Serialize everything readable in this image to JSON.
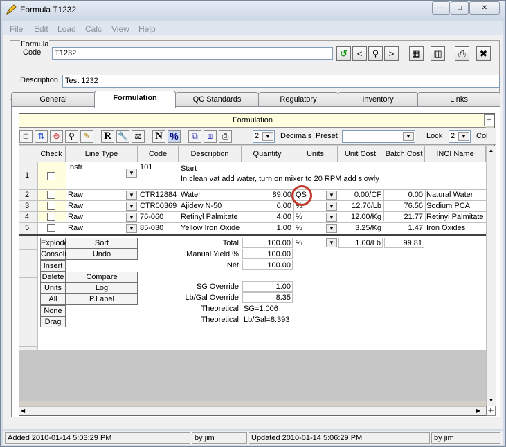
{
  "window": {
    "title": "Formula T1232"
  },
  "menu": [
    "File",
    "Edit",
    "Load",
    "Calc",
    "View",
    "Help"
  ],
  "formula": {
    "group_label": "Formula",
    "code_label": "Code",
    "code_value": "T1232",
    "description_label": "Description",
    "description_value": "Test 1232"
  },
  "tabs": [
    "General",
    "Formulation",
    "QC Standards",
    "Regulatory",
    "Inventory",
    "Links"
  ],
  "active_tab": "Formulation",
  "formulation": {
    "header": "Formulation",
    "decimals_value": "2",
    "decimals_label": "Decimals",
    "preset_label": "Preset",
    "preset_value": "",
    "lock_label": "Lock",
    "lock_value": "2",
    "col_label": "Col",
    "columns": [
      "Check",
      "Line Type",
      "Code",
      "Description",
      "Quantity",
      "Units",
      "Unit Cost",
      "Batch Cost",
      "INCI Name"
    ],
    "rows": [
      {
        "num": "1",
        "type": "Instr",
        "code": "101",
        "desc": "Start",
        "desc2": "In clean vat add water, turn on mixer to 20 RPM add slowly",
        "qty": "",
        "units": "",
        "unit_cost": "",
        "batch_cost": "",
        "inci": ""
      },
      {
        "num": "2",
        "type": "Raw",
        "code": "CTR12884",
        "desc": "Water",
        "qty": "89.00",
        "units": "QS",
        "unit_cost": "0.00/CF",
        "batch_cost": "0.00",
        "inci": "Natural Water"
      },
      {
        "num": "3",
        "type": "Raw",
        "code": "CTR00369",
        "desc": "Ajidew N-50",
        "qty": "6.00",
        "units": "%",
        "unit_cost": "12.76/Lb",
        "batch_cost": "76.56",
        "inci": "Sodium PCA"
      },
      {
        "num": "4",
        "type": "Raw",
        "code": "76-060",
        "desc": "Retinyl Palmitate",
        "qty": "4.00",
        "units": "%",
        "unit_cost": "12.00/Kg",
        "batch_cost": "21.77",
        "inci": "Retinyl Palmitate"
      },
      {
        "num": "5",
        "type": "Raw",
        "code": "85-030",
        "desc": "Yellow Iron Oxide",
        "qty": "1.00",
        "units": "%",
        "unit_cost": "3.25/Kg",
        "batch_cost": "1.47",
        "inci": "Iron Oxides"
      }
    ],
    "buttons_left": [
      "Explode",
      "Consoli",
      "Insert",
      "Delete",
      "Units",
      "All",
      "None",
      "Drag"
    ],
    "buttons_mid": [
      "Sort",
      "Undo",
      "Compare",
      "Log",
      "P.Label"
    ],
    "totals": {
      "total_label": "Total",
      "total_qty": "100.00",
      "total_units": "%",
      "total_unit_cost": "1.00/Lb",
      "total_batch_cost": "99.81",
      "yield_label": "Manual Yield %",
      "yield_value": "100.00",
      "net_label": "Net",
      "net_value": "100.00",
      "sg_label": "SG Override",
      "sg_value": "1.00",
      "lbgal_label": "Lb/Gal Override",
      "lbgal_value": "8.35",
      "theo1_label": "Theoretical",
      "theo1_value": "SG=1.006",
      "theo2_label": "Theoretical",
      "theo2_value": "Lb/Gal=8.393"
    }
  },
  "status": {
    "added": "Added 2010-01-14 5:03:29 PM",
    "added_by": "by jim",
    "updated": "Updated 2010-01-14 5:06:29 PM",
    "updated_by": "by jim"
  },
  "colors": {
    "highlight_circle": "#c0392b",
    "header_yellow": "#ffffe0",
    "check_col": "#ffffe0"
  }
}
